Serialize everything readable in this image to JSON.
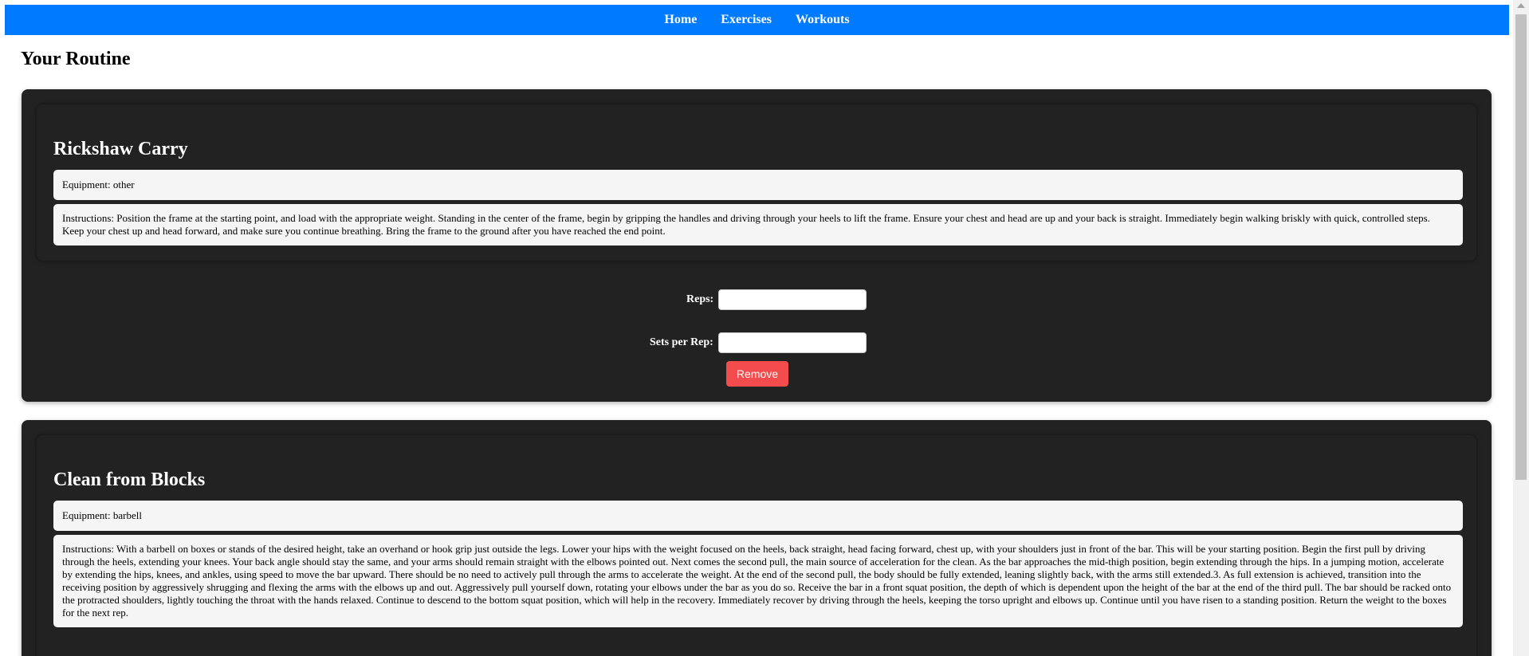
{
  "nav": {
    "items": [
      {
        "label": "Home"
      },
      {
        "label": "Exercises"
      },
      {
        "label": "Workouts"
      }
    ]
  },
  "page": {
    "title": "Your Routine"
  },
  "routine": [
    {
      "name": "Rickshaw Carry",
      "equipment": "Equipment: other",
      "instructions": "Instructions: Position the frame at the starting point, and load with the appropriate weight. Standing in the center of the frame, begin by gripping the handles and driving through your heels to lift the frame. Ensure your chest and head are up and your back is straight. Immediately begin walking briskly with quick, controlled steps. Keep your chest up and head forward, and make sure you continue breathing. Bring the frame to the ground after you have reached the end point.",
      "reps_label": "Reps:",
      "reps_value": "",
      "sets_label": "Sets per Rep:",
      "sets_value": "",
      "remove_label": "Remove"
    },
    {
      "name": "Clean from Blocks",
      "equipment": "Equipment: barbell",
      "instructions": "Instructions: With a barbell on boxes or stands of the desired height, take an overhand or hook grip just outside the legs. Lower your hips with the weight focused on the heels, back straight, head facing forward, chest up, with your shoulders just in front of the bar. This will be your starting position. Begin the first pull by driving through the heels, extending your knees. Your back angle should stay the same, and your arms should remain straight with the elbows pointed out. Next comes the second pull, the main source of acceleration for the clean. As the bar approaches the mid-thigh position, begin extending through the hips. In a jumping motion, accelerate by extending the hips, knees, and ankles, using speed to move the bar upward. There should be no need to actively pull through the arms to accelerate the weight. At the end of the second pull, the body should be fully extended, leaning slightly back, with the arms still extended.3. As full extension is achieved, transition into the receiving position by aggressively shrugging and flexing the arms with the elbows up and out. Aggressively pull yourself down, rotating your elbows under the bar as you do so. Receive the bar in a front squat position, the depth of which is dependent upon the height of the bar at the end of the third pull. The bar should be racked onto the protracted shoulders, lightly touching the throat with the hands relaxed. Continue to descend to the bottom squat position, which will help in the recovery. Immediately recover by driving through the heels, keeping the torso upright and elbows up. Continue until you have risen to a standing position. Return the weight to the boxes for the next rep."
    }
  ],
  "colors": {
    "nav_bg": "#007bff",
    "card_bg": "#222222",
    "info_bg": "#f5f5f5",
    "remove_bg": "#f44c4c"
  }
}
